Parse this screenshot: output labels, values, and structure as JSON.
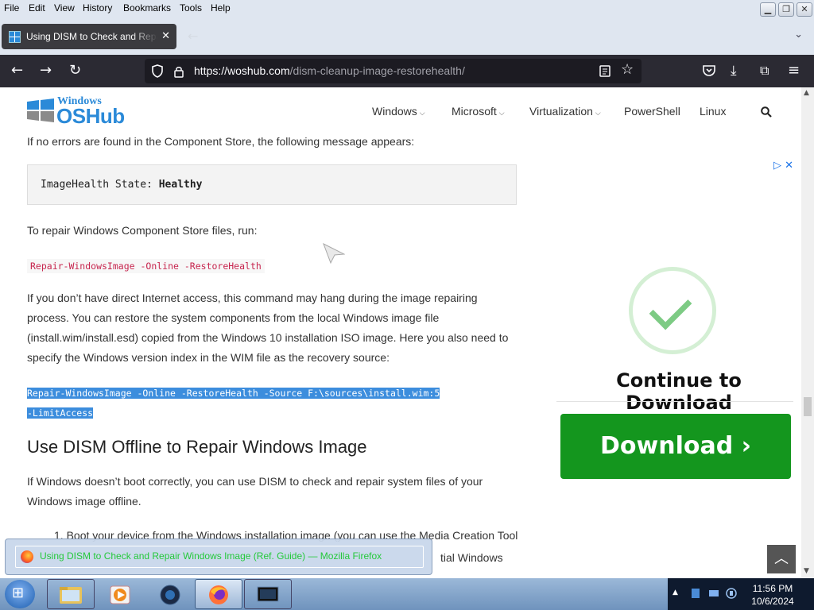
{
  "menu": {
    "file": "File",
    "edit": "Edit",
    "view": "View",
    "history": "History",
    "bookmarks": "Bookmarks",
    "tools": "Tools",
    "help": "Help"
  },
  "tab": {
    "title": "Using DISM to Check and Repair Windows Image"
  },
  "url": {
    "domain": "https://woshub.com",
    "path": "/dism-cleanup-image-restorehealth/"
  },
  "site": {
    "logo_top": "Windows",
    "logo_bottom": "OSHub",
    "nav": [
      "Windows",
      "Microsoft",
      "Virtualization",
      "PowerShell",
      "Linux"
    ]
  },
  "article": {
    "p1": "If no errors are found in the Component Store, the following message appears:",
    "pre_label": "ImageHealth State: ",
    "pre_value": "Healthy",
    "p2": "To repair Windows Component Store files, run:",
    "code1": "Repair-WindowsImage -Online -RestoreHealth",
    "p3": "If you don’t have direct Internet access, this command may hang during the image repairing process. You can restore the system components from the local Windows image file (install.wim/install.esd) copied from the Windows 10 installation ISO image. Here you also need to specify the Windows version index in the WIM file as the recovery source:",
    "code2_line1": "Repair-WindowsImage -Online -RestoreHealth -Source F:\\sources\\install.wim:5",
    "code2_line2": "-LimitAccess",
    "h2": "Use DISM Offline to Repair Windows Image",
    "p4": "If Windows doesn’t boot correctly, you can use DISM to check and repair system files of your Windows image offline.",
    "li1_visible": "1. Boot your device from the Windows installation image (you can use the Media Creation Tool",
    "li1_partial": "tial Windows"
  },
  "ad": {
    "title": "Continue to Download",
    "button": "Download ›"
  },
  "taskbar": {
    "preview_title": "Using DISM to Check and Repair Windows Image (Ref. Guide) — Mozilla Firefox",
    "time": "11:56 PM",
    "date": "10/6/2024"
  },
  "colors": {
    "nav_bg": "#2b2a33",
    "accent": "#2b8ad8",
    "download_green": "#14961e",
    "code_red": "#c7254e",
    "selection": "#3c8ddd"
  }
}
